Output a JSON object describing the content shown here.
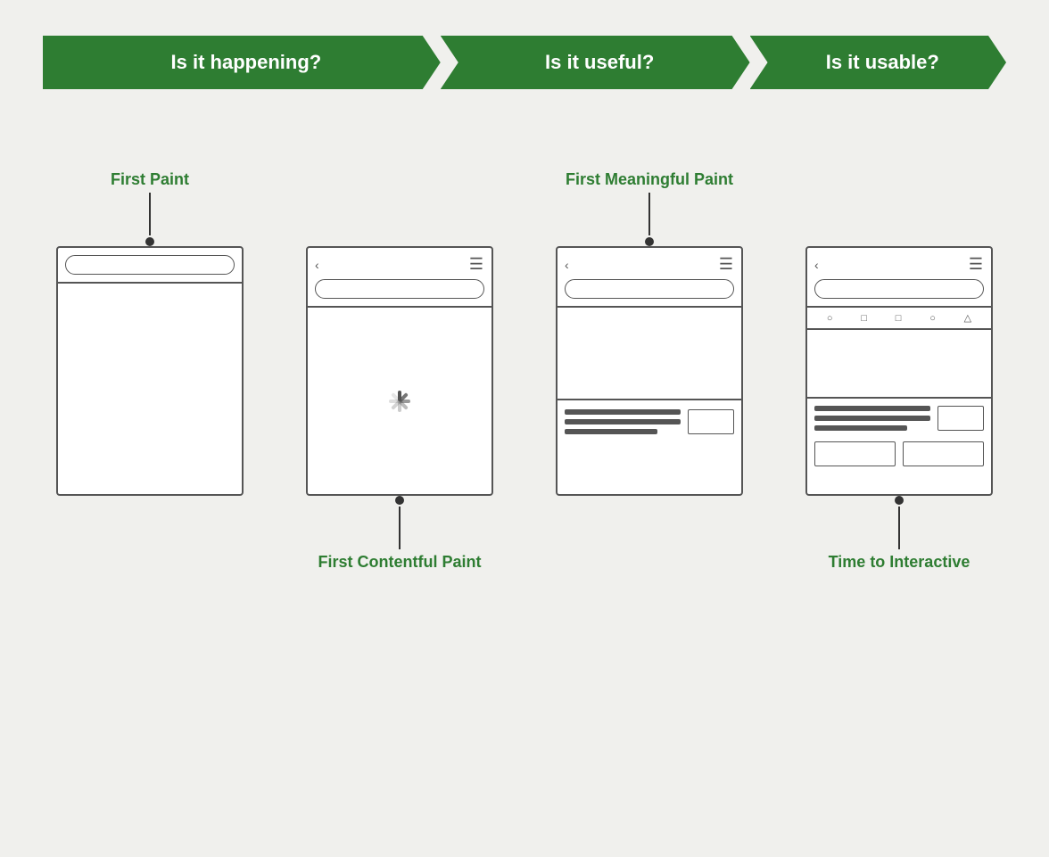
{
  "banner": {
    "arrows": [
      {
        "id": "happening",
        "label": "Is it happening?",
        "size": "large first"
      },
      {
        "id": "useful",
        "label": "Is it useful?",
        "size": "medium"
      },
      {
        "id": "usable",
        "label": "Is it usable?",
        "size": "small"
      }
    ]
  },
  "mockups": [
    {
      "id": "first-paint",
      "label_above": "First Paint",
      "label_below": "",
      "connector": "above",
      "type": "empty"
    },
    {
      "id": "first-contentful-paint",
      "label_above": "",
      "label_below": "First Contentful Paint",
      "connector": "below",
      "type": "spinner"
    },
    {
      "id": "first-meaningful-paint",
      "label_above": "First Meaningful Paint",
      "label_below": "",
      "connector": "above",
      "type": "content"
    },
    {
      "id": "time-to-interactive",
      "label_above": "",
      "label_below": "Time to Interactive",
      "connector": "below",
      "type": "interactive"
    }
  ]
}
